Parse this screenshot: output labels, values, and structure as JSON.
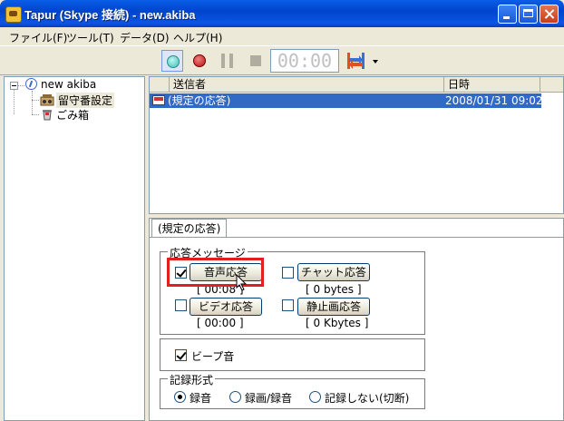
{
  "window": {
    "title": "Tapur (Skype 接続) - new.akiba"
  },
  "menu": [
    "ファイル(F)",
    "ツール(T)",
    "データ(D)",
    "ヘルプ(H)"
  ],
  "toolbar": {
    "time": "00:00"
  },
  "tree": {
    "root": "new akiba",
    "items": [
      "留守番設定",
      "ごみ箱"
    ]
  },
  "list": {
    "columns": [
      "送信者",
      "日時"
    ],
    "rows": [
      {
        "sender": "(規定の応答)",
        "datetime": "2008/01/31 09:02"
      }
    ]
  },
  "tab": {
    "label": "(規定の応答)"
  },
  "response": {
    "legend": "応答メッセージ",
    "voice": {
      "label": "音声応答",
      "checked": true,
      "info": "[ 00:08 ]"
    },
    "chat": {
      "label": "チャット応答",
      "checked": false,
      "info": "[ 0 bytes ]"
    },
    "video": {
      "label": "ビデオ応答",
      "checked": false,
      "info": "[ 00:00 ]"
    },
    "still": {
      "label": "静止画応答",
      "checked": false,
      "info": "[ 0 Kbytes ]"
    }
  },
  "beep": {
    "label": "ビープ音",
    "checked": true
  },
  "record": {
    "legend": "記録形式",
    "options": [
      "録音",
      "録画/録音",
      "記録しない(切断)"
    ],
    "selected": "録音"
  }
}
